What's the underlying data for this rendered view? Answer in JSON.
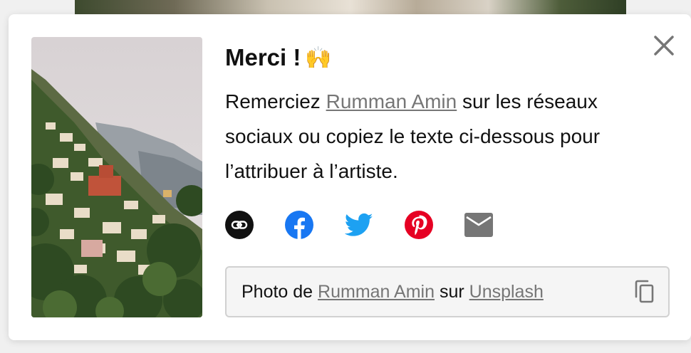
{
  "dialog": {
    "title": "Merci !",
    "title_emoji": "🙌",
    "description_before": "Remerciez ",
    "artist_name": "Rumman Amin",
    "description_after": " sur les réseaux sociaux ou copiez le texte ci-dessous pour l’attribuer à l’artiste.",
    "close_icon": "close-icon"
  },
  "socials": [
    {
      "name": "copy-link",
      "icon": "link-icon",
      "color": "#111111"
    },
    {
      "name": "facebook",
      "icon": "facebook-icon",
      "color": "#1877f2"
    },
    {
      "name": "twitter",
      "icon": "twitter-icon",
      "color": "#1da1f2"
    },
    {
      "name": "pinterest",
      "icon": "pinterest-icon",
      "color": "#e60023"
    },
    {
      "name": "email",
      "icon": "email-icon",
      "color": "#767676"
    }
  ],
  "credit": {
    "prefix": "Photo de ",
    "artist_name": "Rumman Amin",
    "middle": " sur ",
    "platform": "Unsplash",
    "copy_icon": "copy-icon"
  }
}
